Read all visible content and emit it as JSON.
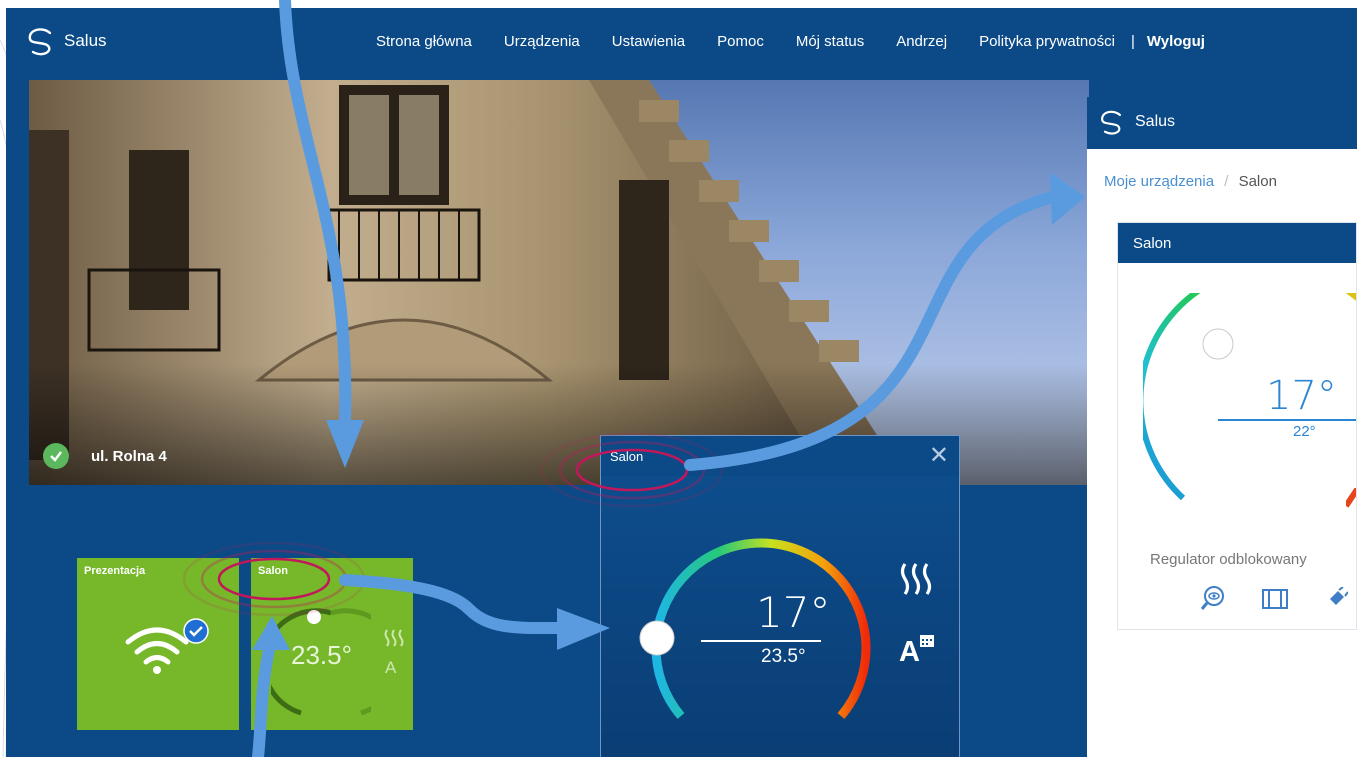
{
  "app": {
    "title": "Salus"
  },
  "nav": {
    "links": [
      "Strona główna",
      "Urządzenia",
      "Ustawienia",
      "Pomoc",
      "Mój status",
      "Andrzej",
      "Polityka prywatności"
    ],
    "separator": "|",
    "logout": "Wyloguj"
  },
  "hero": {
    "location": "ul. Rolna 4"
  },
  "tiles": {
    "presentation": {
      "title": "Prezentacja"
    },
    "salon": {
      "title": "Salon",
      "temperature": "23.5°"
    }
  },
  "popup": {
    "title": "Salon",
    "close": "✕",
    "setpoint": "17°",
    "current": "23.5°",
    "mode_icon": "A"
  },
  "right_panel": {
    "app_title": "Salus",
    "breadcrumb": {
      "parent": "Moje urządzenia",
      "separator": "/",
      "current": "Salon"
    },
    "card": {
      "title": "Salon",
      "setpoint": "17°",
      "current": "22°",
      "status": "Regulator odblokowany"
    }
  },
  "colors": {
    "primary": "#0b4a86",
    "tile_green": "#76b82a",
    "arrow": "#5a9be0",
    "highlight_ring": "#c2185b",
    "ok": "#5cb85c"
  }
}
